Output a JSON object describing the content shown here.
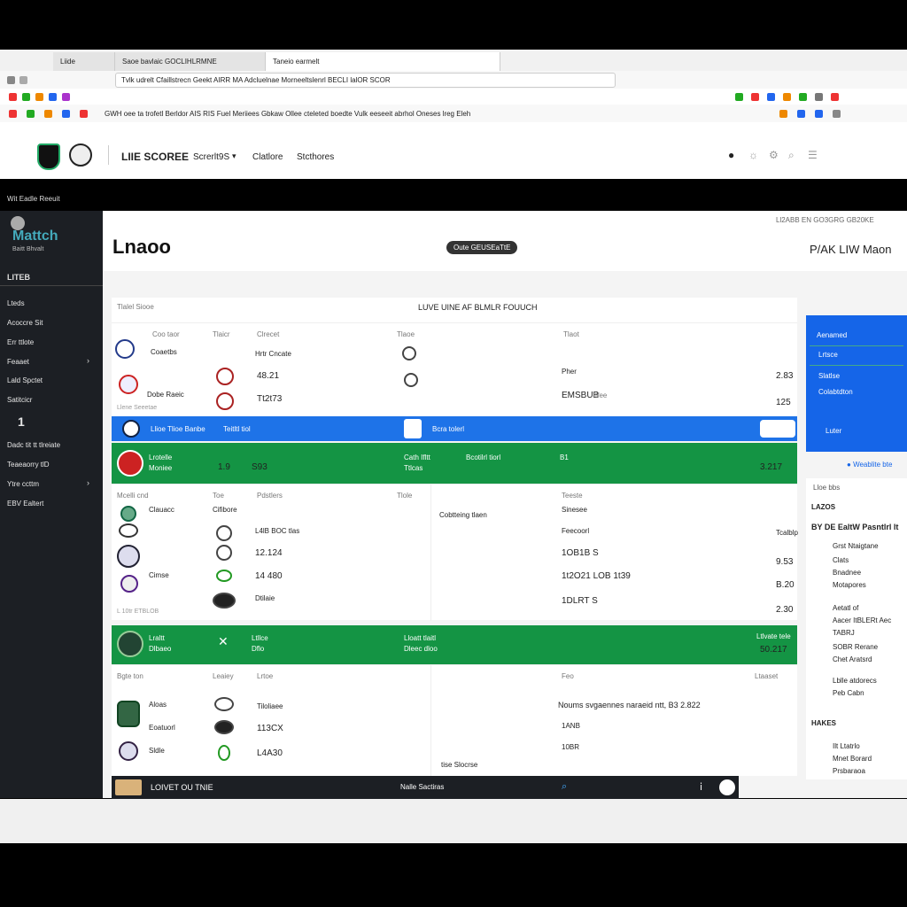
{
  "browser": {
    "tabs": [
      "Liide",
      "Saoe bavlaic GOCLIHLRMNE",
      "Taneio earmelt"
    ],
    "address": "Tvlk udrelt Cfaillstrecn Geekt AIRR MA Adcluelnae Morneeltslenrl BECLI lalOR SCOR",
    "bookmarks_line": "GWH oee ta trofetl Berldor AIS RIS Fuel Meriiees Gbkaw Ollee cteleted boedte Vulk eeseeit abrhol Oneses lreg Eleh"
  },
  "site": {
    "brand": "LIIE SCOREE",
    "nav": [
      "Screrlt9S",
      "Clatlore",
      "Stcthores"
    ]
  },
  "strip_text": "Wit Eadle Reeuit",
  "sidebar": {
    "logo_text": "Mattch",
    "logo_sub": "Baitt Bhvalt",
    "heading": "LITEB",
    "items": [
      "Lteds",
      "Acoccre Sit",
      "Err ttlote",
      "Feaaet",
      "Lald Spctet",
      "Satitcicr",
      "1",
      "Dadc tit tt tlreiate",
      "Teaeaorry tlD",
      "Ytre ccttm",
      "EBV Ealtert"
    ]
  },
  "main": {
    "title": "Lnaoo",
    "pill": "Oute GEUSEaTtE",
    "live_label": "P/AK LIW Maon",
    "meta": "Ll2ABB EN GO3GRG GB20KE",
    "panel_caption": "Tlalel Siooe",
    "section_title": "LUVE UINE AF BLMLR FOUUCH"
  },
  "panel1": {
    "col_head": [
      "Coo taor",
      "Tlaicr",
      "Clrecet",
      "Tlaoe",
      "Tlaot"
    ],
    "row_a": [
      "Coaetbs",
      "Hrtr Cncate",
      "2.83"
    ],
    "row_b": [
      "Dobe Raeic",
      "48.21",
      "Pher"
    ],
    "row_c": [
      "Tt2t73",
      "EMSBUB",
      "tfee"
    ],
    "score_right": "125",
    "footer": "Llene Seeetae"
  },
  "blue_bar": {
    "team": "Llioe Tlioe Banbe",
    "mid": "Teitltl tiol",
    "right": "Bcra tolerl"
  },
  "green_bar1": {
    "l1": "Lrotelle",
    "l2": "Moniee",
    "score1": "1.9",
    "score2": "S93",
    "mid": "Cath Ifltt",
    "mid2": "Ttlcas",
    "far": "Bcotilrl tiorl",
    "flag": "B1",
    "right": "3.217"
  },
  "panel2": {
    "col_head": [
      "Mcelli cnd",
      "Toe",
      "Pdstlers",
      "Tlole",
      "Teeste"
    ],
    "rows": [
      "Clauacc",
      "Cifibore",
      "Cobtteing tlaen",
      "Sinesee",
      "L4lB BOC tlas",
      "Feecoorl",
      "Tcalblp",
      "12.124",
      "1OB1B S",
      "9.53",
      "Cimse",
      "14 480",
      "1t2O21 LOB 1t39",
      "B.20",
      "Dtilaie",
      "1DLRT S",
      "2.30"
    ],
    "footer": "L 10tr ETBLOB"
  },
  "green_bar2": {
    "l1": "Lraltt",
    "l2": "Dlbaeo",
    "mid": "Ltllce",
    "mid2": "Dflo",
    "far": "Lloatt tlaitl",
    "far2": "Dleec dloo",
    "right1": "Ltlvate tele",
    "right": "50.217"
  },
  "panel3": {
    "col_head": [
      "Bgte ton",
      "Leaiey",
      "Lrtoe",
      "Feo",
      "Ltaaset"
    ],
    "rows": [
      "Aloas",
      "Tiloliaee",
      "113CX",
      "Eoatuorl",
      "Sldle",
      "L4A30",
      "Noums svgaennes naraeid ntt, B3 2.822",
      "1ANB",
      "10BR",
      "tise Slocrse"
    ]
  },
  "right_panel": {
    "items": [
      "Aenamed",
      "Lrtsce",
      "Slatlse",
      "Colabtdton",
      "Luter"
    ],
    "link": "Weablite bte",
    "mini_head": "Lloe bbs",
    "section": "LAZOS",
    "heading": "BY DE EaltW Pasntlrl lt",
    "list": [
      "Grst Ntaigtane",
      "Clats",
      "Bnadnee",
      "Motapores",
      "Aetatl of",
      "Aacer ItBLERt Aec",
      "TABRJ",
      "SOBR Rerane",
      "Chet Aratsrd",
      "Lblle atdorecs",
      "Peb Cabn"
    ],
    "section2": "HAKES",
    "list2": [
      "Ilt Ltatrlo",
      "Mnet Borard",
      "Prsbaraoa"
    ]
  },
  "bottom_bar": {
    "left": "LOIVET OU TNIE",
    "mid": "Nalle Sactiras"
  },
  "colors": {
    "blue": "#1e73e8",
    "green": "#149444",
    "sidebar": "#1c1f24"
  }
}
